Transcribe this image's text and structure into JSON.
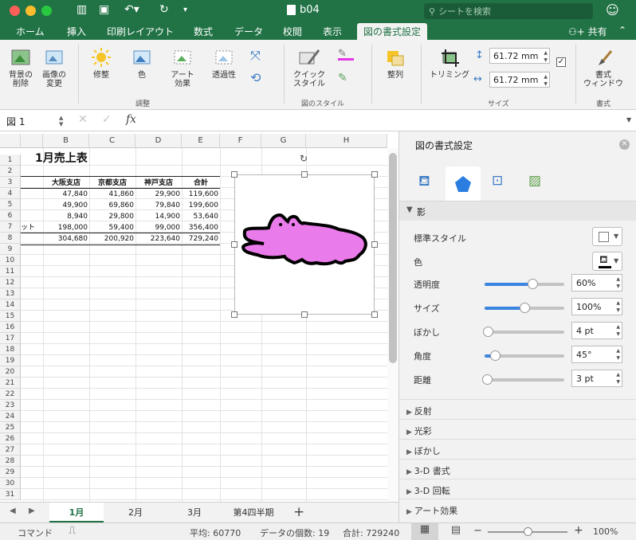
{
  "window": {
    "title": "b04"
  },
  "search": {
    "placeholder": "シートを検索"
  },
  "tabs": [
    "ホーム",
    "挿入",
    "印刷レイアウト",
    "数式",
    "データ",
    "校閲",
    "表示",
    "図の書式設定"
  ],
  "share_label": "共有",
  "ribbon": {
    "remove_bg": [
      "背景の",
      "削除"
    ],
    "change_pic": [
      "画像の",
      "変更"
    ],
    "corrections": "修整",
    "color": "色",
    "artistic": [
      "アート",
      "効果"
    ],
    "transparency": "透過性",
    "group_adjust": "調整",
    "quick_styles": [
      "クイック",
      "スタイル"
    ],
    "group_styles": "図のスタイル",
    "arrange": "整列",
    "crop": "トリミング",
    "height": "61.72 mm",
    "width": "61.72 mm",
    "group_size": "サイズ",
    "format_window": [
      "書式",
      "ウィンドウ"
    ],
    "group_format": "書式"
  },
  "formula_bar": {
    "name_box": "図 1",
    "fx": "fx"
  },
  "columns": [
    "B",
    "C",
    "D",
    "E",
    "F",
    "G",
    "H"
  ],
  "rows": [
    "1",
    "2",
    "3",
    "4",
    "5",
    "6",
    "7",
    "8",
    "9",
    "10",
    "11",
    "12",
    "13",
    "14",
    "15",
    "16",
    "17",
    "18",
    "19",
    "20",
    "21",
    "22",
    "23",
    "24",
    "25",
    "26",
    "27",
    "28",
    "29",
    "30",
    "31"
  ],
  "sheet": {
    "title": "1月売上表",
    "headers": [
      "大阪支店",
      "京都支店",
      "神戸支店",
      "合計"
    ],
    "data": [
      [
        "",
        "47,840",
        "41,860",
        "29,900",
        "119,600"
      ],
      [
        "",
        "49,900",
        "69,860",
        "79,840",
        "199,600"
      ],
      [
        "",
        "8,940",
        "29,800",
        "14,900",
        "53,640"
      ],
      [
        "ット",
        "198,000",
        "59,400",
        "99,000",
        "356,400"
      ],
      [
        "",
        "304,680",
        "200,920",
        "223,640",
        "729,240"
      ]
    ]
  },
  "sheet_tabs": [
    "1月",
    "2月",
    "3月",
    "第4四半期"
  ],
  "status": {
    "mode": "コマンド",
    "average": "平均: 60770",
    "count": "データの個数: 19",
    "sum": "合計: 729240",
    "zoom": "100%",
    "zoom_level": 0.5
  },
  "pane": {
    "title": "図の書式設定",
    "section": "影",
    "preset_label": "標準スタイル",
    "color_label": "色",
    "props": [
      {
        "label": "透明度",
        "value": "60%",
        "level": 0.6
      },
      {
        "label": "サイズ",
        "value": "100%",
        "level": 0.5
      },
      {
        "label": "ぼかし",
        "value": "4 pt",
        "level": 0.04
      },
      {
        "label": "角度",
        "value": "45°",
        "level": 0.125
      },
      {
        "label": "距離",
        "value": "3 pt",
        "level": 0.03
      }
    ],
    "sections": [
      "反射",
      "光彩",
      "ぼかし",
      "3-D 書式",
      "3-D 回転",
      "アート効果"
    ]
  },
  "colors": {
    "accent": "#217346",
    "picture": "#ea7bea"
  }
}
